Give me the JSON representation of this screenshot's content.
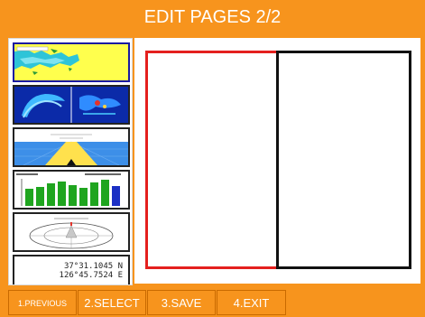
{
  "header": {
    "title": "EDIT PAGES 2/2"
  },
  "sidebar": {
    "thumbnails": [
      {
        "name": "chart-map-thumbnail",
        "icon": "chart-map-icon"
      },
      {
        "name": "radar-split-thumbnail",
        "icon": "radar-icon"
      },
      {
        "name": "highway-3d-thumbnail",
        "icon": "highway-icon"
      },
      {
        "name": "bar-graph-thumbnail",
        "icon": "bar-graph-icon"
      },
      {
        "name": "compass-thumbnail",
        "icon": "compass-icon"
      },
      {
        "name": "gps-position-thumbnail",
        "icon": "gps-readout-icon",
        "line1": "37°31.1045 N",
        "line2": "126°45.7524 E"
      }
    ]
  },
  "softkeys": [
    {
      "label": "1.PREVIOUS"
    },
    {
      "label": "2.SELECT"
    },
    {
      "label": "3.SAVE"
    },
    {
      "label": "4.EXIT"
    }
  ],
  "colors": {
    "accent": "#f7941d",
    "selected_pane": "#e4201e",
    "unselected_pane": "#111111",
    "selected_thumb": "#1a1aa0"
  }
}
